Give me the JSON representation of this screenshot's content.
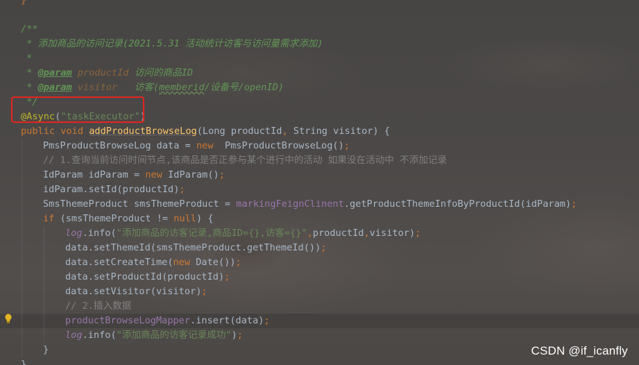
{
  "editor": {
    "lines": [
      {
        "segments": [
          {
            "cls": "punct",
            "text": "}"
          }
        ],
        "indent": 0
      },
      {
        "segments": [],
        "indent": 0
      },
      {
        "segments": [
          {
            "cls": "doc",
            "text": "/**"
          }
        ],
        "indent": 0
      },
      {
        "segments": [
          {
            "cls": "doc",
            "text": " * 添加商品的访问记录(2021.5.31 活动统计访客与访问量需求添加)"
          }
        ],
        "indent": 0
      },
      {
        "segments": [
          {
            "cls": "doc",
            "text": " *"
          }
        ],
        "indent": 0
      },
      {
        "segments": [
          {
            "cls": "doc",
            "text": " * "
          },
          {
            "cls": "doctag",
            "text": "@param"
          },
          {
            "cls": "docparam",
            "text": " productId"
          },
          {
            "cls": "doc",
            "text": " 访问的商品ID"
          }
        ],
        "indent": 0
      },
      {
        "segments": [
          {
            "cls": "doc",
            "text": " * "
          },
          {
            "cls": "doctag",
            "text": "@param"
          },
          {
            "cls": "docparam",
            "text": " visitor"
          },
          {
            "cls": "doc",
            "text": "   访客("
          },
          {
            "cls": "doc underline-wavy",
            "text": "memberid"
          },
          {
            "cls": "doc",
            "text": "/设备号/openID)"
          }
        ],
        "indent": 0
      },
      {
        "segments": [
          {
            "cls": "doc",
            "text": " */"
          }
        ],
        "indent": 0
      },
      {
        "segments": [
          {
            "cls": "ann",
            "text": "@Async"
          },
          {
            "cls": "",
            "text": "("
          },
          {
            "cls": "str",
            "text": "\"taskExecutor\""
          },
          {
            "cls": "",
            "text": ")"
          }
        ],
        "indent": 0
      },
      {
        "segments": [
          {
            "cls": "kw",
            "text": "public void "
          },
          {
            "cls": "fn",
            "text": "addProductBrowseLog"
          },
          {
            "cls": "",
            "text": "(Long productId"
          },
          {
            "cls": "punct",
            "text": ", "
          },
          {
            "cls": "",
            "text": "String visitor) {"
          }
        ],
        "indent": 0
      },
      {
        "segments": [
          {
            "cls": "",
            "text": "PmsProductBrowseLog data = "
          },
          {
            "cls": "kw",
            "text": "new  "
          },
          {
            "cls": "",
            "text": "PmsProductBrowseLog()"
          },
          {
            "cls": "punct",
            "text": ";"
          }
        ],
        "indent": 1
      },
      {
        "segments": [
          {
            "cls": "cmt",
            "text": "// 1.查询当前访问时间节点,该商品是否正参与某个进行中的活动 如果没在活动中 不添加记录"
          }
        ],
        "indent": 1
      },
      {
        "segments": [
          {
            "cls": "",
            "text": "IdParam idParam = "
          },
          {
            "cls": "kw",
            "text": "new "
          },
          {
            "cls": "",
            "text": "IdParam()"
          },
          {
            "cls": "punct",
            "text": ";"
          }
        ],
        "indent": 1
      },
      {
        "segments": [
          {
            "cls": "",
            "text": "idParam.setId(productId)"
          },
          {
            "cls": "punct",
            "text": ";"
          }
        ],
        "indent": 1
      },
      {
        "segments": [
          {
            "cls": "",
            "text": "SmsThemeProduct smsThemeProduct = "
          },
          {
            "cls": "field",
            "text": "markingFeignClinent"
          },
          {
            "cls": "",
            "text": ".getProductThemeInfoByProductId(idParam)"
          },
          {
            "cls": "punct",
            "text": ";"
          }
        ],
        "indent": 1
      },
      {
        "segments": [
          {
            "cls": "kw",
            "text": "if "
          },
          {
            "cls": "",
            "text": "(smsThemeProduct != "
          },
          {
            "cls": "kw",
            "text": "null"
          },
          {
            "cls": "",
            "text": ") {"
          }
        ],
        "indent": 1
      },
      {
        "segments": [
          {
            "cls": "ital-field",
            "text": "log"
          },
          {
            "cls": "",
            "text": ".info("
          },
          {
            "cls": "str",
            "text": "\"添加商品的访客记录,商品ID={},访客={}\""
          },
          {
            "cls": "punct",
            "text": ","
          },
          {
            "cls": "",
            "text": "productId"
          },
          {
            "cls": "punct",
            "text": ","
          },
          {
            "cls": "",
            "text": "visitor)"
          },
          {
            "cls": "punct",
            "text": ";"
          }
        ],
        "indent": 2
      },
      {
        "segments": [
          {
            "cls": "",
            "text": "data.setThemeId(smsThemeProduct.getThemeId())"
          },
          {
            "cls": "punct",
            "text": ";"
          }
        ],
        "indent": 2
      },
      {
        "segments": [
          {
            "cls": "",
            "text": "data.setCreateTime("
          },
          {
            "cls": "kw",
            "text": "new "
          },
          {
            "cls": "",
            "text": "Date())"
          },
          {
            "cls": "punct",
            "text": ";"
          }
        ],
        "indent": 2
      },
      {
        "segments": [
          {
            "cls": "",
            "text": "data.setProductId(productId)"
          },
          {
            "cls": "punct",
            "text": ";"
          }
        ],
        "indent": 2
      },
      {
        "segments": [
          {
            "cls": "",
            "text": "data.setVisitor(visitor)"
          },
          {
            "cls": "punct",
            "text": ";"
          }
        ],
        "indent": 2
      },
      {
        "segments": [
          {
            "cls": "cmt",
            "text": "// 2.插入数据"
          }
        ],
        "indent": 2
      },
      {
        "segments": [
          {
            "cls": "field",
            "text": "productBrowseLogMapper"
          },
          {
            "cls": "",
            "text": ".insert(data)"
          },
          {
            "cls": "punct",
            "text": ";"
          }
        ],
        "indent": 2
      },
      {
        "segments": [
          {
            "cls": "ital-field",
            "text": "log"
          },
          {
            "cls": "",
            "text": ".info("
          },
          {
            "cls": "str",
            "text": "\"添加商品的访客记录成功\""
          },
          {
            "cls": "",
            "text": ")"
          },
          {
            "cls": "punct",
            "text": ";"
          }
        ],
        "indent": 2
      },
      {
        "segments": [
          {
            "cls": "",
            "text": "}"
          }
        ],
        "indent": 1
      },
      {
        "segments": [
          {
            "cls": "",
            "text": "}"
          }
        ],
        "indent": 0
      }
    ],
    "current_line": 22
  },
  "watermark": "CSDN @if_icanfly",
  "colors": {
    "keyword": "#cc7832",
    "string": "#6a8759",
    "comment": "#808080",
    "javadoc": "#629755",
    "annotation": "#bbb529",
    "method": "#ffc66d",
    "field": "#9876aa",
    "highlight_box": "#e8231f"
  },
  "icons": {
    "gutter": "lightbulb-icon"
  }
}
